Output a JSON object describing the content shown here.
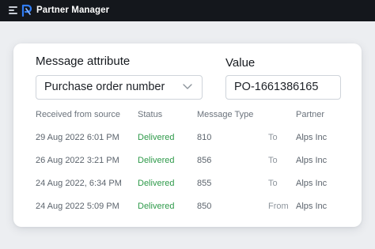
{
  "topbar": {
    "menu_icon": "hamburger-menu-icon",
    "logo_icon": "partner-manager-logo-icon",
    "title": "Partner Manager"
  },
  "filters": {
    "attribute_label": "Message attribute",
    "attribute_value": "Purchase order number",
    "value_label": "Value",
    "value_input": "PO-1661386165"
  },
  "table": {
    "columns": [
      "Received from source",
      "Status",
      "Message Type",
      "Partner"
    ],
    "rows": [
      {
        "received": "29 Aug 2022  6:01 PM",
        "status": "Delivered",
        "message_type": "810",
        "direction": "To",
        "partner": "Alps Inc"
      },
      {
        "received": "26 Aug 2022  3:21 PM",
        "status": "Delivered",
        "message_type": "856",
        "direction": "To",
        "partner": "Alps Inc"
      },
      {
        "received": "24 Aug 2022, 6:34 PM",
        "status": "Delivered",
        "message_type": "855",
        "direction": "To",
        "partner": "Alps Inc"
      },
      {
        "received": "24 Aug 2022  5:09 PM",
        "status": "Delivered",
        "message_type": "850",
        "direction": "From",
        "partner": "Alps Inc"
      }
    ]
  },
  "colors": {
    "topbar_bg": "#14171c",
    "accent": "#2f7cf6",
    "status_delivered": "#2e9a4a",
    "page_bg": "#eceef1"
  }
}
